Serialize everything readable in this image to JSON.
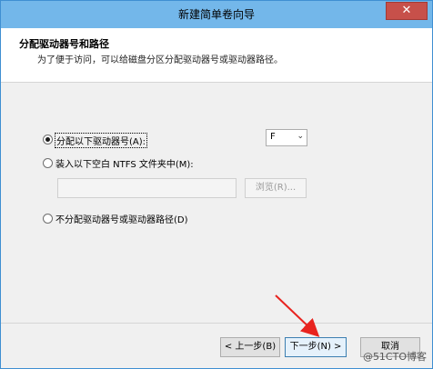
{
  "window": {
    "title": "新建简单卷向导",
    "close_glyph": "✕"
  },
  "header": {
    "title": "分配驱动器号和路径",
    "description": "为了便于访问，可以给磁盘分区分配驱动器号或驱动器路径。"
  },
  "options": {
    "assign_letter": {
      "label": "分配以下驱动器号(A):",
      "checked": true
    },
    "drive_letter": {
      "value": "F",
      "arrow": "⌄"
    },
    "mount_folder": {
      "label": "装入以下空白 NTFS 文件夹中(M):",
      "checked": false
    },
    "path_value": "",
    "browse_label": "浏览(R)...",
    "no_assign": {
      "label": "不分配驱动器号或驱动器路径(D)",
      "checked": false
    }
  },
  "footer": {
    "back_label": "< 上一步(B)",
    "next_label": "下一步(N) >",
    "cancel_label": "取消"
  },
  "annotation": {
    "arrow_color": "#e8231f"
  },
  "watermark": "@51CTO博客"
}
